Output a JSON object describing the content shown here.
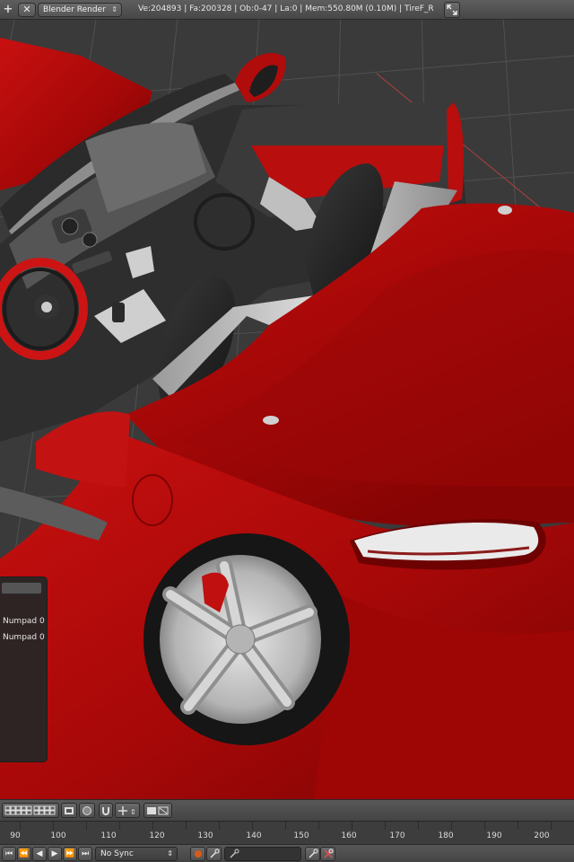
{
  "header": {
    "menu_icon": "plus-icon",
    "close_symbol": "✕",
    "render_engine": "Blender Render",
    "stats": "Ve:204893 | Fa:200328 | Ob:0-47 | La:0 | Mem:550.80M (0.10M) | TireF_R",
    "maximize_icon": "fullscreen-arrows-icon"
  },
  "viewport": {
    "subject": "red roadster car model",
    "grid_color": "#4d4d4d",
    "car_color": "#b30a0a"
  },
  "operator_panel": {
    "rows": [
      "Numpad 0",
      "Numpad 0"
    ]
  },
  "view_header": {
    "icons": [
      "layer-grid-icon",
      "render-layer-icon",
      "overlay-circle-icon",
      "snap-magnet-icon",
      "pivot-icon",
      "render-preview-icon",
      "clapperboard-icon"
    ]
  },
  "timeline": {
    "labels": [
      "90",
      "100",
      "110",
      "120",
      "130",
      "140",
      "150",
      "160",
      "170",
      "180",
      "190",
      "200"
    ]
  },
  "playback": {
    "sync_mode": "No Sync",
    "buttons": [
      "jump-start-icon",
      "jump-keyframe-back-icon",
      "play-reverse-icon",
      "play-icon",
      "jump-keyframe-forward-icon",
      "jump-end-icon"
    ],
    "record_color": "#d85a1a"
  }
}
